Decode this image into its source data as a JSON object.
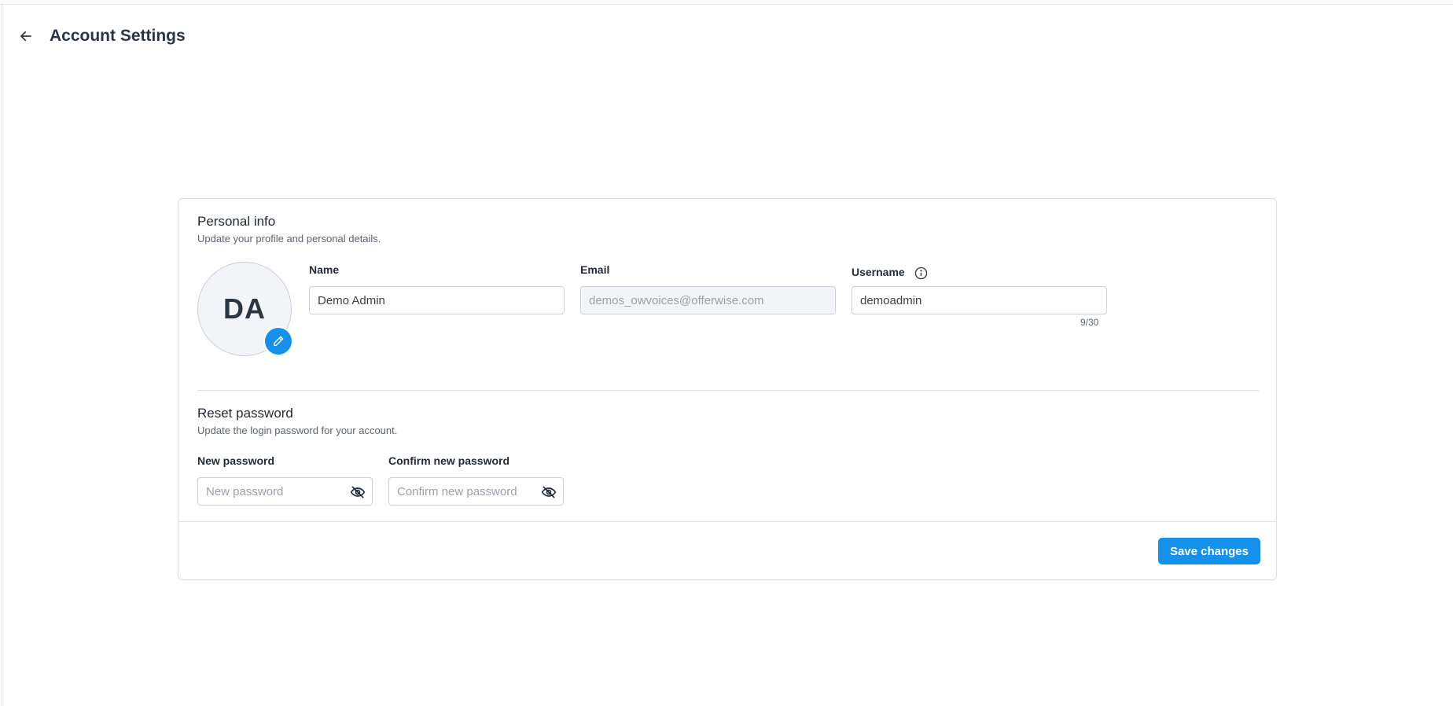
{
  "header": {
    "title": "Account Settings",
    "back_icon": "arrow-left-icon"
  },
  "personal_info": {
    "title": "Personal info",
    "subtitle": "Update your profile and personal details.",
    "avatar_initials": "DA",
    "avatar_edit_icon": "pencil-icon",
    "name_label": "Name",
    "name_value": "Demo Admin",
    "email_label": "Email",
    "email_value": "demos_owvoices@offerwise.com",
    "username_label": "Username",
    "username_info_icon": "info-icon",
    "username_value": "demoadmin",
    "username_count": "9/30"
  },
  "reset_password": {
    "title": "Reset password",
    "subtitle": "Update the login password for your account.",
    "new_label": "New password",
    "new_placeholder": "New password",
    "confirm_label": "Confirm new password",
    "confirm_placeholder": "Confirm new password",
    "toggle_icon": "eye-off-icon"
  },
  "footer": {
    "save_label": "Save changes"
  },
  "colors": {
    "accent": "#1591ea",
    "border": "#cdd2d9",
    "disabled_bg": "#f3f4f7"
  }
}
